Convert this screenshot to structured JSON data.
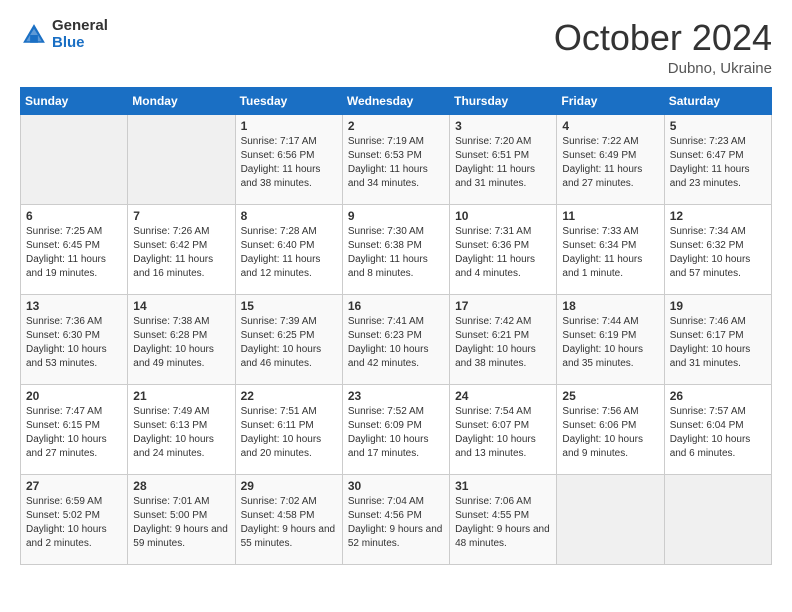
{
  "header": {
    "logo_general": "General",
    "logo_blue": "Blue",
    "month_title": "October 2024",
    "location": "Dubno, Ukraine"
  },
  "days_of_week": [
    "Sunday",
    "Monday",
    "Tuesday",
    "Wednesday",
    "Thursday",
    "Friday",
    "Saturday"
  ],
  "weeks": [
    [
      {
        "day": "",
        "sunrise": "",
        "sunset": "",
        "daylight": ""
      },
      {
        "day": "",
        "sunrise": "",
        "sunset": "",
        "daylight": ""
      },
      {
        "day": "1",
        "sunrise": "Sunrise: 7:17 AM",
        "sunset": "Sunset: 6:56 PM",
        "daylight": "Daylight: 11 hours and 38 minutes."
      },
      {
        "day": "2",
        "sunrise": "Sunrise: 7:19 AM",
        "sunset": "Sunset: 6:53 PM",
        "daylight": "Daylight: 11 hours and 34 minutes."
      },
      {
        "day": "3",
        "sunrise": "Sunrise: 7:20 AM",
        "sunset": "Sunset: 6:51 PM",
        "daylight": "Daylight: 11 hours and 31 minutes."
      },
      {
        "day": "4",
        "sunrise": "Sunrise: 7:22 AM",
        "sunset": "Sunset: 6:49 PM",
        "daylight": "Daylight: 11 hours and 27 minutes."
      },
      {
        "day": "5",
        "sunrise": "Sunrise: 7:23 AM",
        "sunset": "Sunset: 6:47 PM",
        "daylight": "Daylight: 11 hours and 23 minutes."
      }
    ],
    [
      {
        "day": "6",
        "sunrise": "Sunrise: 7:25 AM",
        "sunset": "Sunset: 6:45 PM",
        "daylight": "Daylight: 11 hours and 19 minutes."
      },
      {
        "day": "7",
        "sunrise": "Sunrise: 7:26 AM",
        "sunset": "Sunset: 6:42 PM",
        "daylight": "Daylight: 11 hours and 16 minutes."
      },
      {
        "day": "8",
        "sunrise": "Sunrise: 7:28 AM",
        "sunset": "Sunset: 6:40 PM",
        "daylight": "Daylight: 11 hours and 12 minutes."
      },
      {
        "day": "9",
        "sunrise": "Sunrise: 7:30 AM",
        "sunset": "Sunset: 6:38 PM",
        "daylight": "Daylight: 11 hours and 8 minutes."
      },
      {
        "day": "10",
        "sunrise": "Sunrise: 7:31 AM",
        "sunset": "Sunset: 6:36 PM",
        "daylight": "Daylight: 11 hours and 4 minutes."
      },
      {
        "day": "11",
        "sunrise": "Sunrise: 7:33 AM",
        "sunset": "Sunset: 6:34 PM",
        "daylight": "Daylight: 11 hours and 1 minute."
      },
      {
        "day": "12",
        "sunrise": "Sunrise: 7:34 AM",
        "sunset": "Sunset: 6:32 PM",
        "daylight": "Daylight: 10 hours and 57 minutes."
      }
    ],
    [
      {
        "day": "13",
        "sunrise": "Sunrise: 7:36 AM",
        "sunset": "Sunset: 6:30 PM",
        "daylight": "Daylight: 10 hours and 53 minutes."
      },
      {
        "day": "14",
        "sunrise": "Sunrise: 7:38 AM",
        "sunset": "Sunset: 6:28 PM",
        "daylight": "Daylight: 10 hours and 49 minutes."
      },
      {
        "day": "15",
        "sunrise": "Sunrise: 7:39 AM",
        "sunset": "Sunset: 6:25 PM",
        "daylight": "Daylight: 10 hours and 46 minutes."
      },
      {
        "day": "16",
        "sunrise": "Sunrise: 7:41 AM",
        "sunset": "Sunset: 6:23 PM",
        "daylight": "Daylight: 10 hours and 42 minutes."
      },
      {
        "day": "17",
        "sunrise": "Sunrise: 7:42 AM",
        "sunset": "Sunset: 6:21 PM",
        "daylight": "Daylight: 10 hours and 38 minutes."
      },
      {
        "day": "18",
        "sunrise": "Sunrise: 7:44 AM",
        "sunset": "Sunset: 6:19 PM",
        "daylight": "Daylight: 10 hours and 35 minutes."
      },
      {
        "day": "19",
        "sunrise": "Sunrise: 7:46 AM",
        "sunset": "Sunset: 6:17 PM",
        "daylight": "Daylight: 10 hours and 31 minutes."
      }
    ],
    [
      {
        "day": "20",
        "sunrise": "Sunrise: 7:47 AM",
        "sunset": "Sunset: 6:15 PM",
        "daylight": "Daylight: 10 hours and 27 minutes."
      },
      {
        "day": "21",
        "sunrise": "Sunrise: 7:49 AM",
        "sunset": "Sunset: 6:13 PM",
        "daylight": "Daylight: 10 hours and 24 minutes."
      },
      {
        "day": "22",
        "sunrise": "Sunrise: 7:51 AM",
        "sunset": "Sunset: 6:11 PM",
        "daylight": "Daylight: 10 hours and 20 minutes."
      },
      {
        "day": "23",
        "sunrise": "Sunrise: 7:52 AM",
        "sunset": "Sunset: 6:09 PM",
        "daylight": "Daylight: 10 hours and 17 minutes."
      },
      {
        "day": "24",
        "sunrise": "Sunrise: 7:54 AM",
        "sunset": "Sunset: 6:07 PM",
        "daylight": "Daylight: 10 hours and 13 minutes."
      },
      {
        "day": "25",
        "sunrise": "Sunrise: 7:56 AM",
        "sunset": "Sunset: 6:06 PM",
        "daylight": "Daylight: 10 hours and 9 minutes."
      },
      {
        "day": "26",
        "sunrise": "Sunrise: 7:57 AM",
        "sunset": "Sunset: 6:04 PM",
        "daylight": "Daylight: 10 hours and 6 minutes."
      }
    ],
    [
      {
        "day": "27",
        "sunrise": "Sunrise: 6:59 AM",
        "sunset": "Sunset: 5:02 PM",
        "daylight": "Daylight: 10 hours and 2 minutes."
      },
      {
        "day": "28",
        "sunrise": "Sunrise: 7:01 AM",
        "sunset": "Sunset: 5:00 PM",
        "daylight": "Daylight: 9 hours and 59 minutes."
      },
      {
        "day": "29",
        "sunrise": "Sunrise: 7:02 AM",
        "sunset": "Sunset: 4:58 PM",
        "daylight": "Daylight: 9 hours and 55 minutes."
      },
      {
        "day": "30",
        "sunrise": "Sunrise: 7:04 AM",
        "sunset": "Sunset: 4:56 PM",
        "daylight": "Daylight: 9 hours and 52 minutes."
      },
      {
        "day": "31",
        "sunrise": "Sunrise: 7:06 AM",
        "sunset": "Sunset: 4:55 PM",
        "daylight": "Daylight: 9 hours and 48 minutes."
      },
      {
        "day": "",
        "sunrise": "",
        "sunset": "",
        "daylight": ""
      },
      {
        "day": "",
        "sunrise": "",
        "sunset": "",
        "daylight": ""
      }
    ]
  ]
}
